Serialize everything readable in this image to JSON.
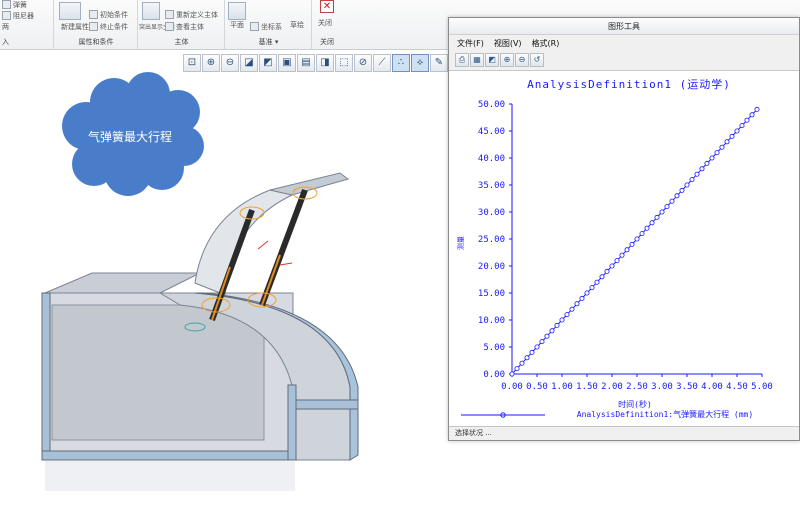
{
  "ribbon": {
    "groups": [
      {
        "label": "入"
      },
      {
        "label": "属性和条件"
      },
      {
        "label": "主体"
      },
      {
        "label": "基准 ▾"
      },
      {
        "label": "关闭"
      }
    ],
    "left_items": [
      "弹簧",
      "阻尼器",
      "两"
    ],
    "attr_items": [
      "初始条件",
      "终止条件",
      "新建属性"
    ],
    "body_items": [
      "重新定义主体",
      "查看主体",
      "突出显示主体"
    ],
    "datum_items": [
      "平面",
      "坐标系",
      "草绘"
    ],
    "close_label": "关闭"
  },
  "view_toolbar": {
    "icons": [
      "refit-icon",
      "zoom-in-icon",
      "zoom-out-icon",
      "repaint-icon",
      "shading-icon",
      "saved-views-icon",
      "layers-icon",
      "display-style-icon",
      "perspective-icon",
      "datum-planes-icon",
      "datum-axes-icon",
      "datum-points-icon",
      "csys-icon",
      "annotations-icon"
    ]
  },
  "callout": {
    "text": "气弹簧最大行程",
    "fill": "#4a7dc9"
  },
  "graph_window": {
    "title": "图形工具",
    "menu": [
      "文件(F)",
      "视图(V)",
      "格式(R)"
    ],
    "status": "选择状况 ..."
  },
  "chart_data": {
    "type": "line",
    "title": "AnalysisDefinition1 (运动学)",
    "xlabel": "时间(秒)",
    "ylabel": "测量",
    "xlim": [
      0,
      5
    ],
    "ylim": [
      0,
      50
    ],
    "xticks": [
      "0.00",
      "0.50",
      "1.00",
      "1.50",
      "2.00",
      "2.50",
      "3.00",
      "3.50",
      "4.00",
      "4.50",
      "5.00"
    ],
    "yticks": [
      "0.00",
      "5.00",
      "10.00",
      "15.00",
      "20.00",
      "25.00",
      "30.00",
      "35.00",
      "40.00",
      "45.00",
      "50.00"
    ],
    "legend": "AnalysisDefinition1:气弹簧最大行程 (mm)",
    "color": "#1a1aff",
    "series": [
      {
        "x": [
          0.0,
          0.1,
          0.2,
          0.3,
          0.4,
          0.5,
          0.6,
          0.7,
          0.8,
          0.9,
          1.0,
          1.1,
          1.2,
          1.3,
          1.4,
          1.5,
          1.6,
          1.7,
          1.8,
          1.9,
          2.0,
          2.1,
          2.2,
          2.3,
          2.4,
          2.5,
          2.6,
          2.7,
          2.8,
          2.9,
          3.0,
          3.1,
          3.2,
          3.3,
          3.4,
          3.5,
          3.6,
          3.7,
          3.8,
          3.9,
          4.0,
          4.1,
          4.2,
          4.3,
          4.4,
          4.5,
          4.6,
          4.7,
          4.8,
          4.9
        ],
        "y": [
          0.0,
          1.0,
          2.0,
          3.0,
          4.0,
          5.0,
          6.0,
          7.0,
          8.0,
          9.0,
          10.0,
          11.0,
          12.0,
          13.0,
          14.0,
          15.0,
          16.0,
          17.0,
          18.0,
          19.0,
          20.0,
          21.0,
          22.0,
          23.0,
          24.0,
          25.0,
          26.0,
          27.0,
          28.0,
          29.0,
          30.0,
          31.0,
          32.0,
          33.0,
          34.0,
          35.0,
          36.0,
          37.0,
          38.0,
          39.0,
          40.0,
          41.0,
          42.0,
          43.0,
          44.0,
          45.0,
          46.0,
          47.0,
          48.0,
          49.0
        ]
      }
    ]
  }
}
